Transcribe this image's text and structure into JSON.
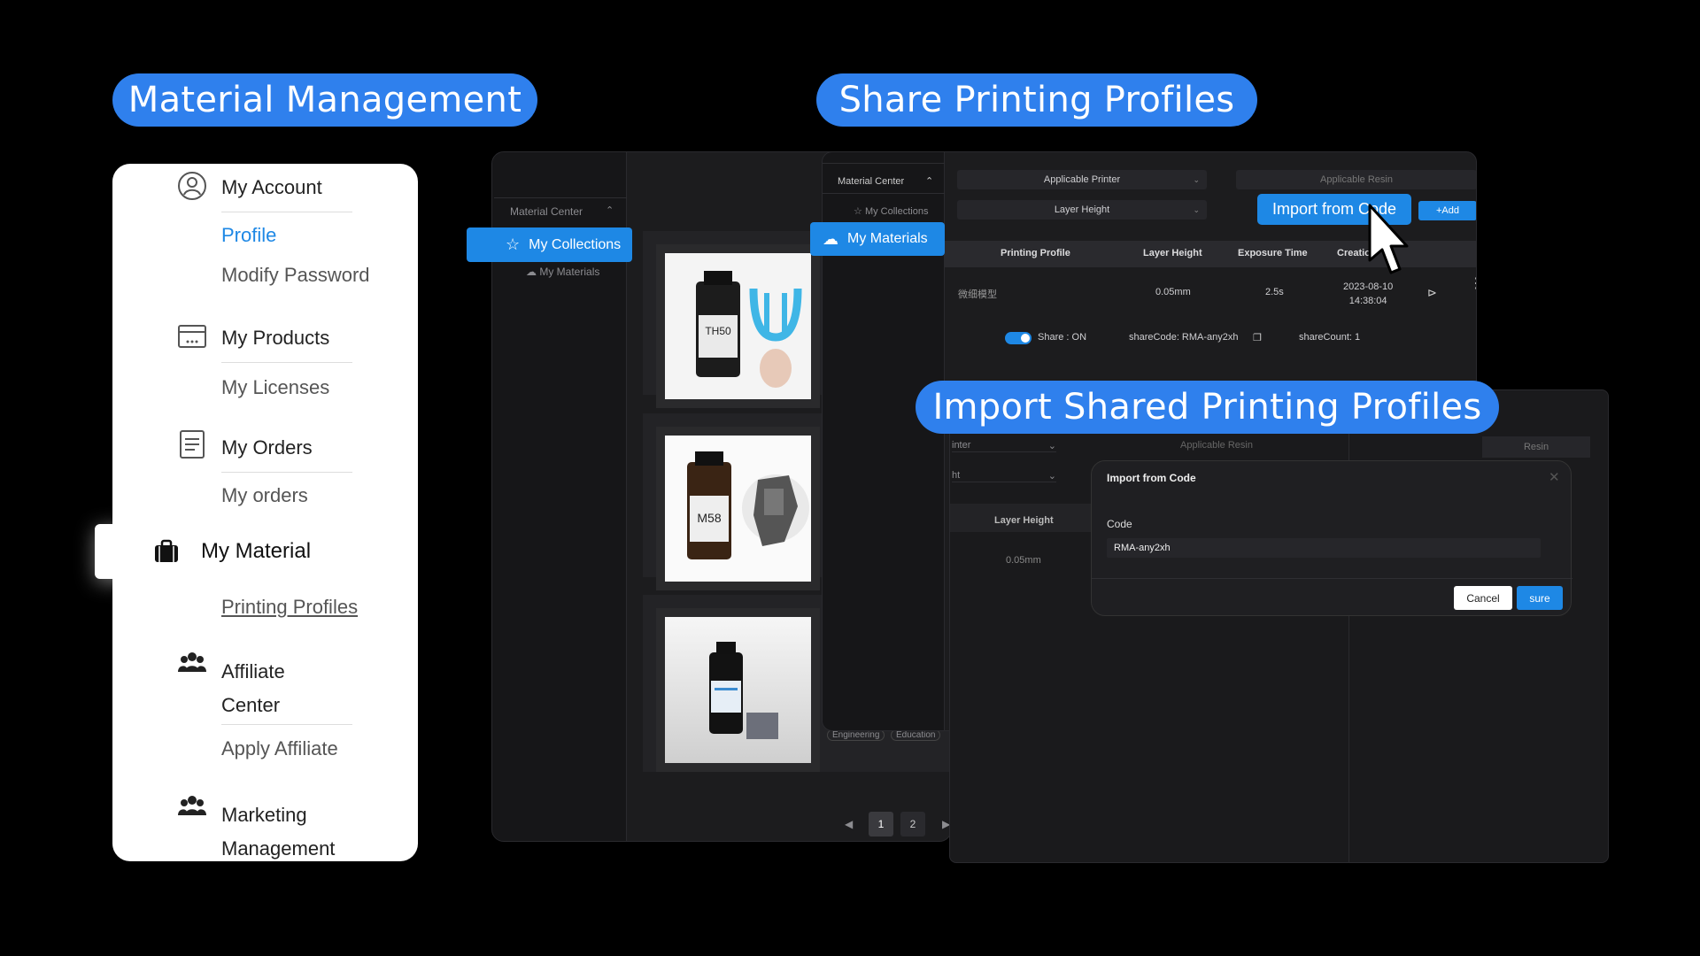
{
  "headings": {
    "material_management": "Material Management",
    "share_profiles": "Share Printing Profiles",
    "import_profiles": "Import Shared Printing Profiles"
  },
  "menu": {
    "my_account": "My Account",
    "profile": "Profile",
    "modify_password": "Modify Password",
    "my_products": "My Products",
    "my_licenses": "My Licenses",
    "my_orders": "My Orders",
    "my_orders_sub": "My orders",
    "my_material": "My Material",
    "printing_profiles": "Printing Profiles",
    "affiliate_center_1": "Affiliate",
    "affiliate_center_2": "Center",
    "apply_affiliate": "Apply Affiliate",
    "marketing_1": "Marketing",
    "marketing_2": "Management"
  },
  "collections_window": {
    "material_center": "Material Center",
    "my_collections": "My Collections",
    "my_materials": "My Materials",
    "products": [
      "TH50",
      "M58",
      ""
    ],
    "tags": [
      "Engineering",
      "Education"
    ],
    "pages": [
      "1",
      "2"
    ]
  },
  "profiles_window": {
    "material_center": "Material Center",
    "my_collections": "My Collections",
    "my_materials": "My Materials",
    "applicable_printer": "Applicable Printer",
    "applicable_resin": "Applicable Resin",
    "layer_height": "Layer Height",
    "import_from_code": "Import from Code",
    "add": "+Add",
    "columns": [
      "Printing Profile",
      "Layer Height",
      "Exposure Time",
      "Creatio"
    ],
    "row": {
      "name": "微细模型",
      "layer_height": "0.05mm",
      "exposure": "2.5s",
      "date": "2023-08-10",
      "time": "14:38:04"
    },
    "share_label": "Share : ON",
    "share_code": "shareCode: RMA-any2xh",
    "share_count": "shareCount: 1"
  },
  "import_window": {
    "printer_partial": "inter",
    "height_partial": "ht",
    "applicable_resin": "Applicable Resin",
    "resin": "Resin",
    "layer_height": "Layer Height",
    "layer_value": "0.05mm",
    "dialog": {
      "title": "Import from Code",
      "code_label": "Code",
      "code_value": "RMA-any2xh",
      "cancel": "Cancel",
      "sure": "sure"
    }
  },
  "colors": {
    "accent": "#1e88e5",
    "pill": "#2f80ed"
  }
}
